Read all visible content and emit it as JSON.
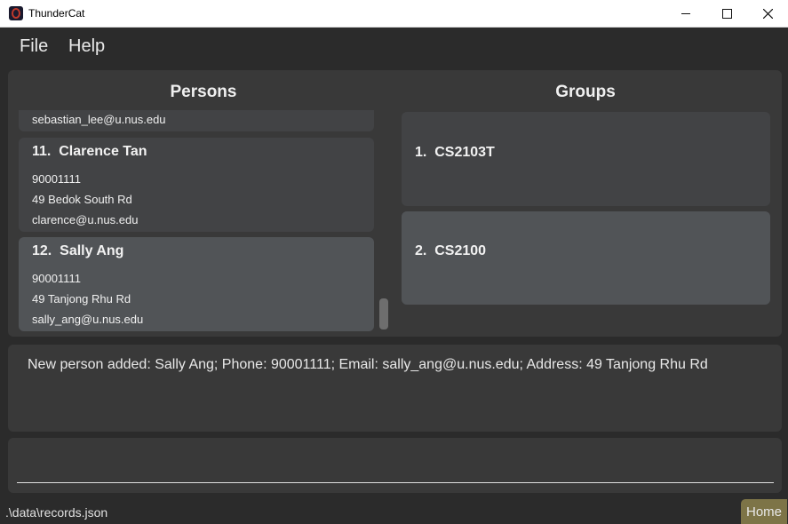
{
  "window": {
    "title": "ThunderCat"
  },
  "menu": {
    "file": "File",
    "help": "Help"
  },
  "persons": {
    "heading": "Persons",
    "partial_email": "sebastian_lee@u.nus.edu",
    "cards": [
      {
        "index": "11.",
        "name": "Clarence Tan",
        "phone": "90001111",
        "address": "49 Bedok South Rd",
        "email": "clarence@u.nus.edu"
      },
      {
        "index": "12.",
        "name": "Sally Ang",
        "phone": "90001111",
        "address": "49 Tanjong Rhu Rd",
        "email": "sally_ang@u.nus.edu"
      }
    ]
  },
  "groups": {
    "heading": "Groups",
    "items": [
      {
        "index": "1.",
        "name": "CS2103T"
      },
      {
        "index": "2.",
        "name": "CS2100"
      }
    ]
  },
  "result": {
    "text": "New person added: Sally Ang; Phone: 90001111; Email: sally_ang@u.nus.edu; Address: 49 Tanjong Rhu Rd"
  },
  "command": {
    "value": ""
  },
  "status": {
    "path": ".\\data\\records.json",
    "home": "Home"
  }
}
